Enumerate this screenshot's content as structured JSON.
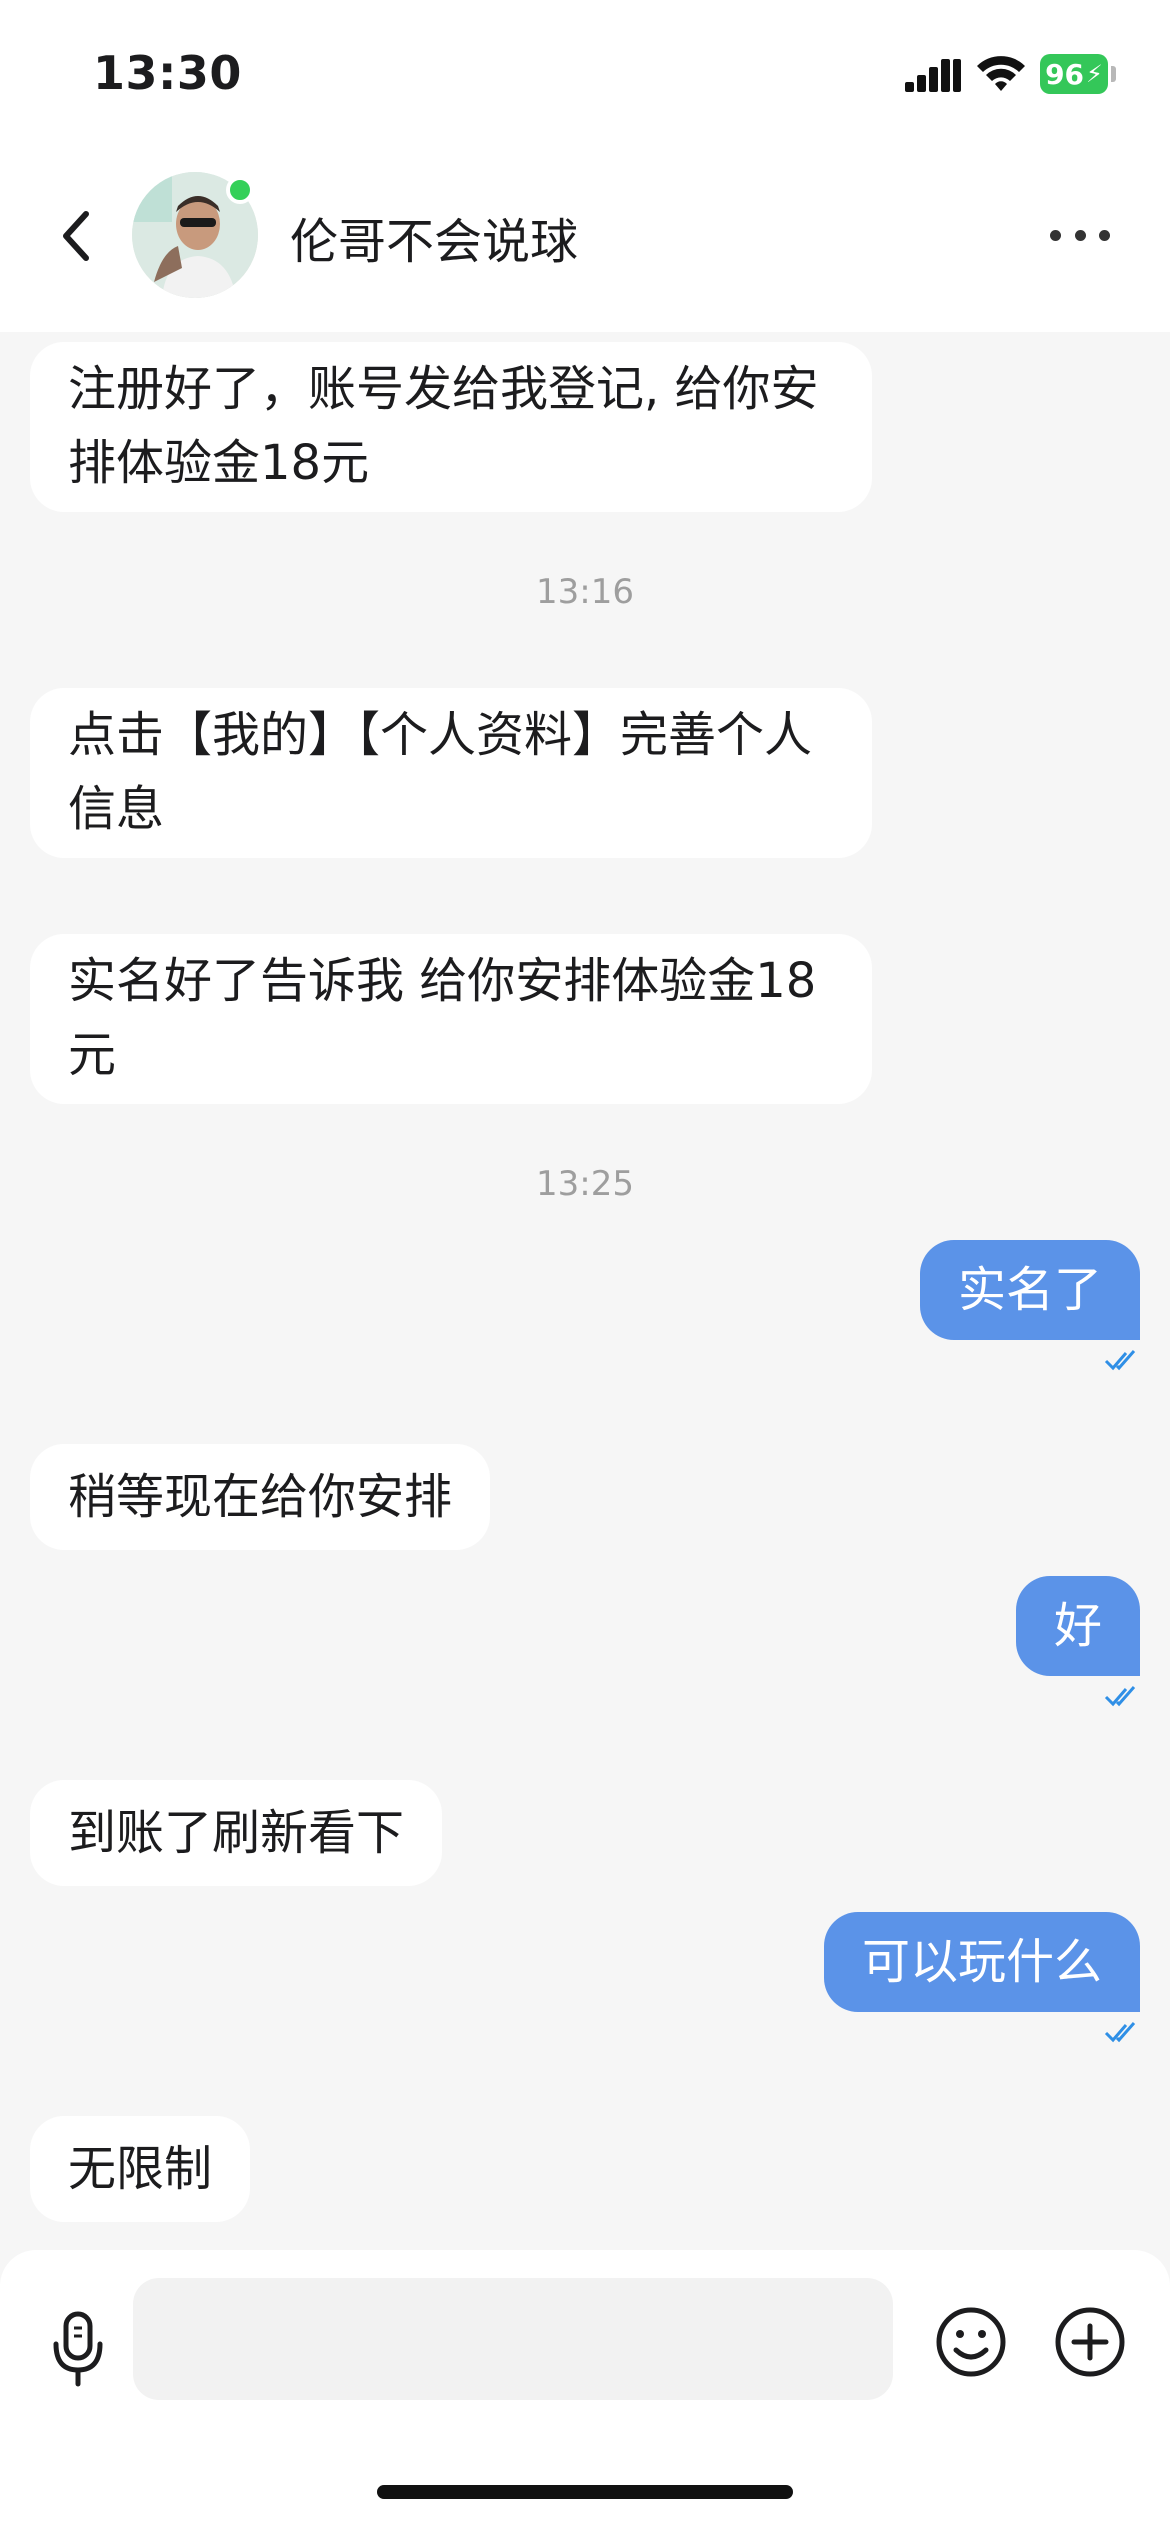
{
  "status_bar": {
    "time": "13:30",
    "battery": "96"
  },
  "header": {
    "contact_name": "伦哥不会说球"
  },
  "messages": [
    {
      "text": "注册好了，账号发给我登记, 给你安排体验金18元"
    },
    {
      "timestamp": "13:16"
    },
    {
      "text": "点击【我的】【个人资料】完善个人信息"
    },
    {
      "text": "实名好了告诉我 给你安排体验金18 元"
    },
    {
      "timestamp": "13:25"
    },
    {
      "text": "实名了"
    },
    {
      "text": "稍等现在给你安排"
    },
    {
      "text": "好"
    },
    {
      "text": "到账了刷新看下"
    },
    {
      "text": "可以玩什么"
    },
    {
      "text": "无限制"
    }
  ],
  "input": {
    "placeholder": ""
  },
  "icons": {
    "back": "chevron-left-icon",
    "more": "more-horizontal-icon",
    "mic": "microphone-icon",
    "emoji": "smiley-icon",
    "plus": "plus-circle-icon",
    "read": "double-check-icon"
  },
  "colors": {
    "outgoing_bubble": "#5b93e8",
    "incoming_bubble": "#ffffff",
    "background": "#f6f6f6",
    "online": "#34d058",
    "battery": "#34c759",
    "read_check": "#2f8fe6"
  }
}
